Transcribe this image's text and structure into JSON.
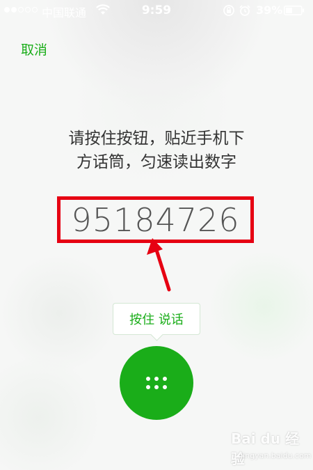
{
  "status_bar": {
    "signal_dots_on": 2,
    "signal_dots_total": 5,
    "carrier": "中国联通",
    "time": "9:59",
    "battery": "39%",
    "icons": [
      "wifi-icon",
      "rotation-lock-icon",
      "alarm-icon",
      "battery-icon"
    ]
  },
  "header": {
    "cancel_label": "取消"
  },
  "main": {
    "instruction_line1": "请按住按钮，贴近手机下",
    "instruction_line2": "方话筒，匀速读出数字",
    "code": "95184726"
  },
  "talk": {
    "tooltip": "按住 说话",
    "button_icon": "dots-grid-icon"
  },
  "watermark": {
    "brand": "Bai du 经验",
    "url": "jingyan.baidu.com"
  },
  "colors": {
    "accent": "#1aad19",
    "highlight_box": "#e60012",
    "text": "#333333"
  }
}
